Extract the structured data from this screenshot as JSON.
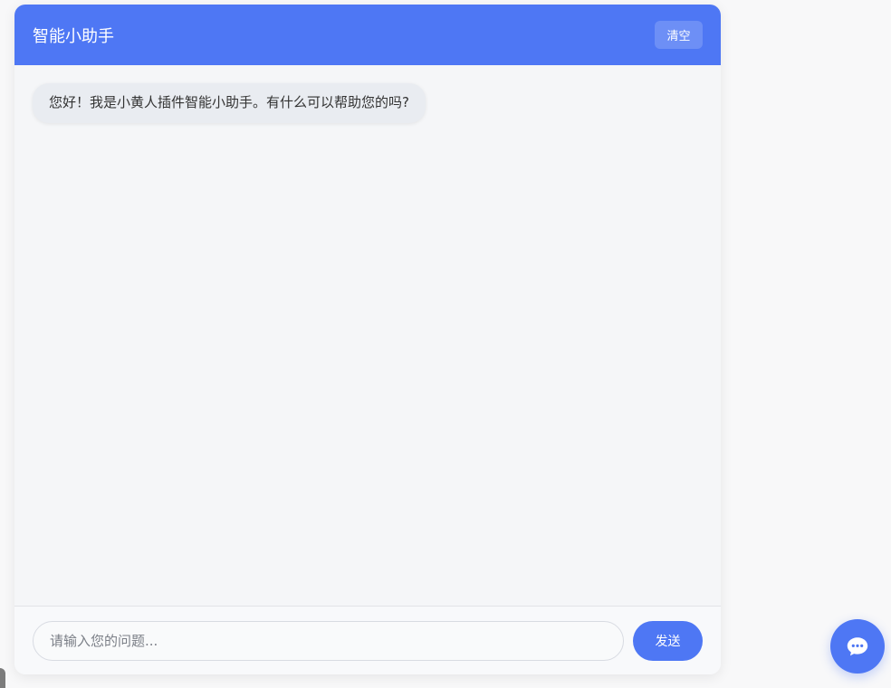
{
  "header": {
    "title": "智能小助手",
    "clear_label": "清空"
  },
  "messages": [
    {
      "role": "assistant",
      "text": "您好！我是小黄人插件智能小助手。有什么可以帮助您的吗?"
    }
  ],
  "composer": {
    "placeholder": "请输入您的问题...",
    "send_label": "发送"
  },
  "floating_button": {
    "icon": "chat-bubble-icon"
  },
  "colors": {
    "accent": "#4e77f4",
    "panel_bg": "#f5f6f8",
    "bubble_bg": "#e9ecf1"
  }
}
